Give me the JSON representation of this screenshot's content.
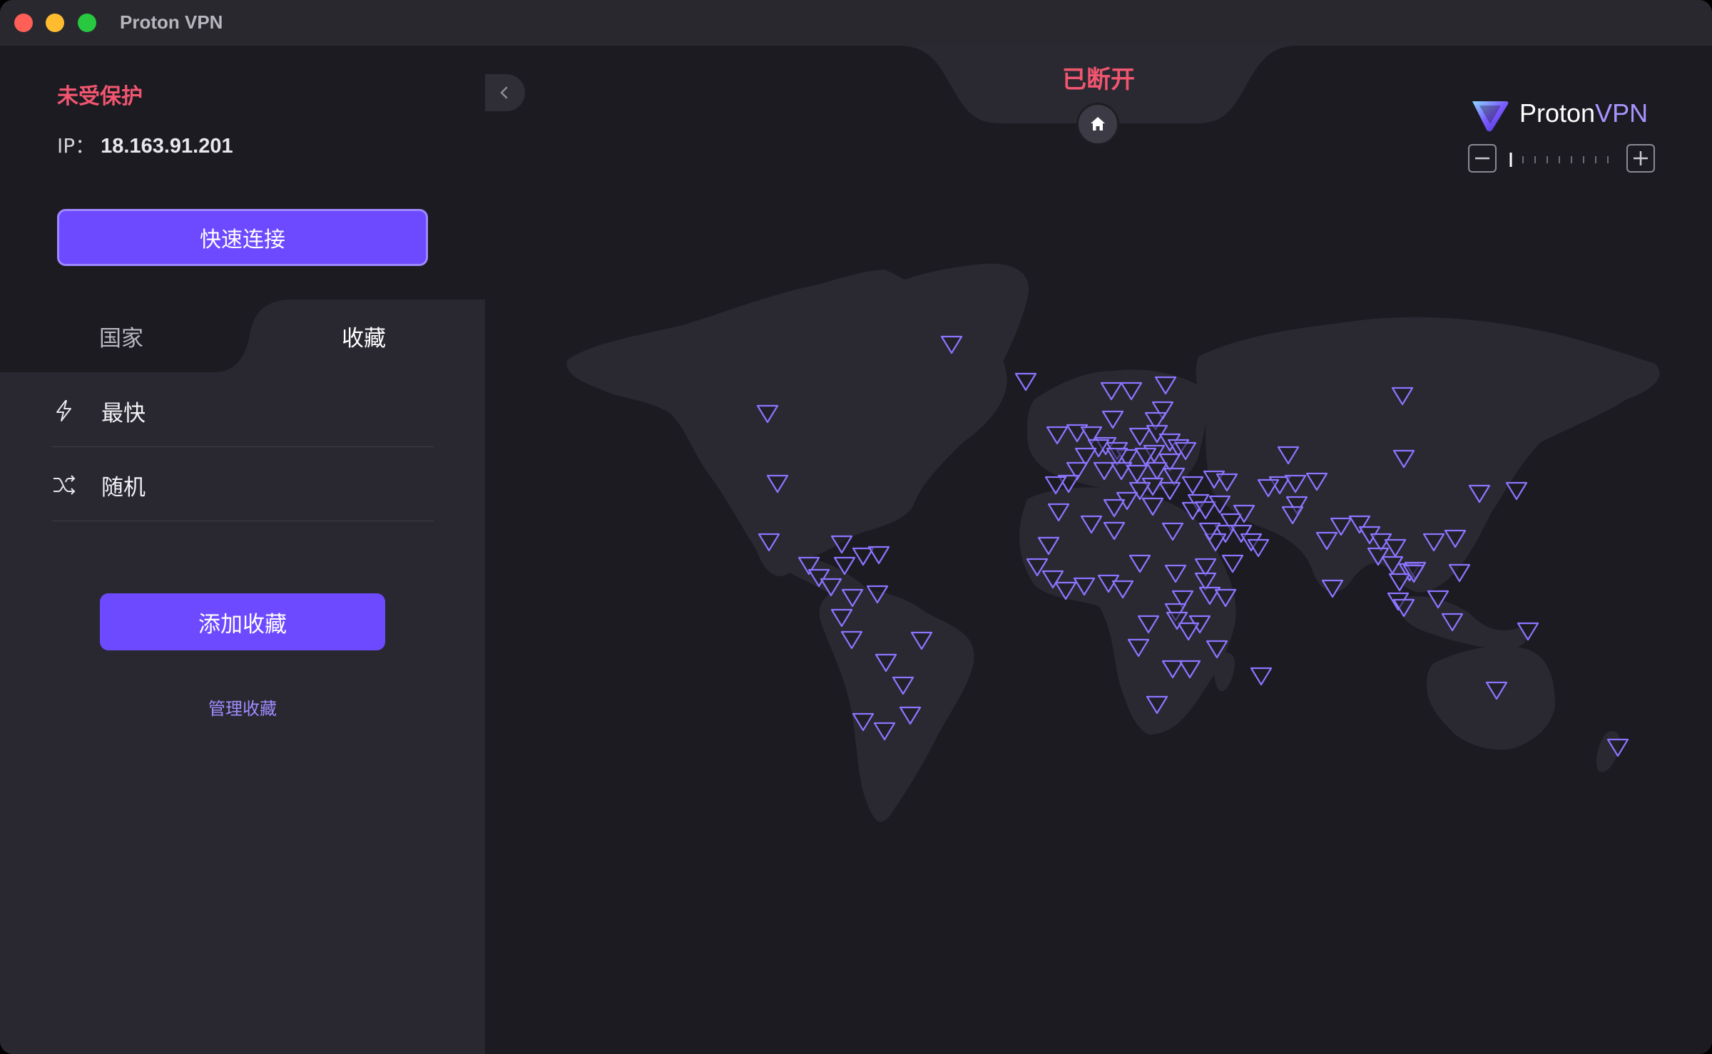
{
  "window": {
    "title": "Proton VPN"
  },
  "sidebar": {
    "status": "未受保护",
    "ip_label": "IP：",
    "ip_value": "18.163.91.201",
    "quick_connect": "快速连接",
    "tabs": [
      {
        "label": "国家",
        "active": false
      },
      {
        "label": "收藏",
        "active": true
      }
    ],
    "items": [
      {
        "label": "最快",
        "icon": "lightning-icon"
      },
      {
        "label": "随机",
        "icon": "shuffle-icon"
      }
    ],
    "add_favorite": "添加收藏",
    "manage_favorites": "管理收藏"
  },
  "map": {
    "connection_status": "已断开",
    "brand_proton": "Proton",
    "brand_vpn": "VPN",
    "zoom_level_index": 0,
    "zoom_levels": 9
  },
  "colors": {
    "accent": "#6d4aff",
    "danger": "#f0566f",
    "marker": "#8d74ff",
    "land": "#2a2932",
    "background": "#1c1b22"
  }
}
